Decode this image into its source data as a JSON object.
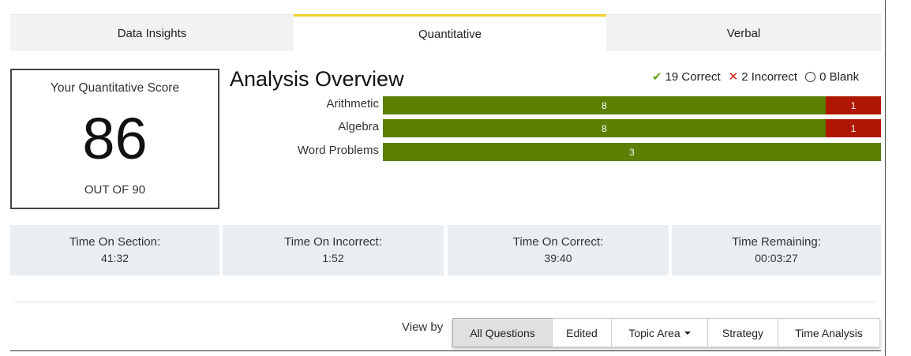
{
  "tabs": [
    {
      "label": "Data Insights"
    },
    {
      "label": "Quantitative"
    },
    {
      "label": "Verbal"
    }
  ],
  "score": {
    "label": "Your Quantitative Score",
    "value": "86",
    "out_of": "OUT OF 90"
  },
  "analysis": {
    "title": "Analysis Overview",
    "legend": {
      "correct": "19 Correct",
      "incorrect": "2 Incorrect",
      "blank": "0 Blank"
    },
    "topics": [
      {
        "label": "Arithmetic",
        "correct": "8",
        "incorrect": "1"
      },
      {
        "label": "Algebra",
        "correct": "8",
        "incorrect": "1"
      },
      {
        "label": "Word Problems",
        "correct": "3",
        "incorrect": ""
      }
    ],
    "colors": {
      "correct": "#5b7f00",
      "incorrect": "#b01702",
      "active_tab": "#f2d32b"
    }
  },
  "times": [
    {
      "label": "Time On Section:",
      "value": "41:32"
    },
    {
      "label": "Time On Incorrect:",
      "value": "1:52"
    },
    {
      "label": "Time On Correct:",
      "value": "39:40"
    },
    {
      "label": "Time Remaining:",
      "value": "00:03:27"
    }
  ],
  "view_by": {
    "label": "View by",
    "buttons": [
      "All Questions",
      "Edited",
      "Topic Area",
      "Strategy",
      "Time Analysis"
    ]
  }
}
